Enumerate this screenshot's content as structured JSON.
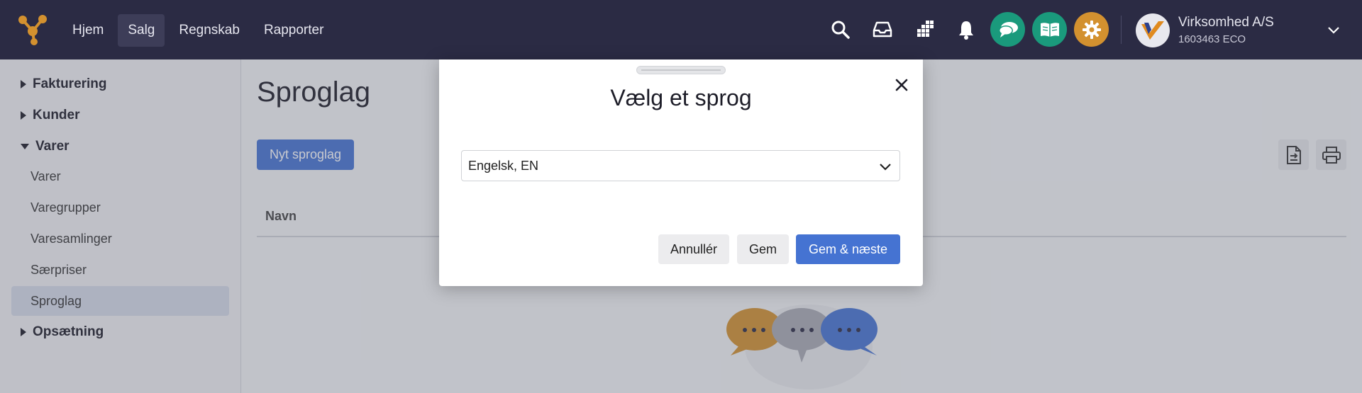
{
  "nav": {
    "items": [
      {
        "label": "Hjem"
      },
      {
        "label": "Salg"
      },
      {
        "label": "Regnskab"
      },
      {
        "label": "Rapporter"
      }
    ]
  },
  "company": {
    "name": "Virksomhed A/S",
    "id": "1603463 ECO"
  },
  "sidebar": {
    "groups": [
      {
        "label": "Fakturering"
      },
      {
        "label": "Kunder"
      },
      {
        "label": "Varer"
      },
      {
        "label": "Opsætning"
      }
    ],
    "items": [
      {
        "label": "Varer"
      },
      {
        "label": "Varegrupper"
      },
      {
        "label": "Varesamlinger"
      },
      {
        "label": "Særpriser"
      },
      {
        "label": "Sproglag"
      }
    ]
  },
  "main": {
    "title": "Sproglag",
    "new_button": "Nyt sproglag",
    "column_name": "Navn"
  },
  "modal": {
    "title": "Vælg et sprog",
    "selected_language": "Engelsk, EN",
    "cancel": "Annullér",
    "save": "Gem",
    "save_next": "Gem & næste"
  },
  "colors": {
    "topbar": "#2b2b44",
    "primary": "#4573d2",
    "accent_teal": "#1a9a7c",
    "accent_orange": "#d3912f"
  },
  "icons": [
    "logo-icon",
    "search-icon",
    "inbox-icon",
    "apps-grid-icon",
    "bell-icon",
    "chat-icon",
    "book-icon",
    "gear-icon",
    "company-logo-icon",
    "chevron-down-icon",
    "export-file-icon",
    "print-icon",
    "close-icon",
    "caret-right-icon",
    "caret-down-icon"
  ]
}
